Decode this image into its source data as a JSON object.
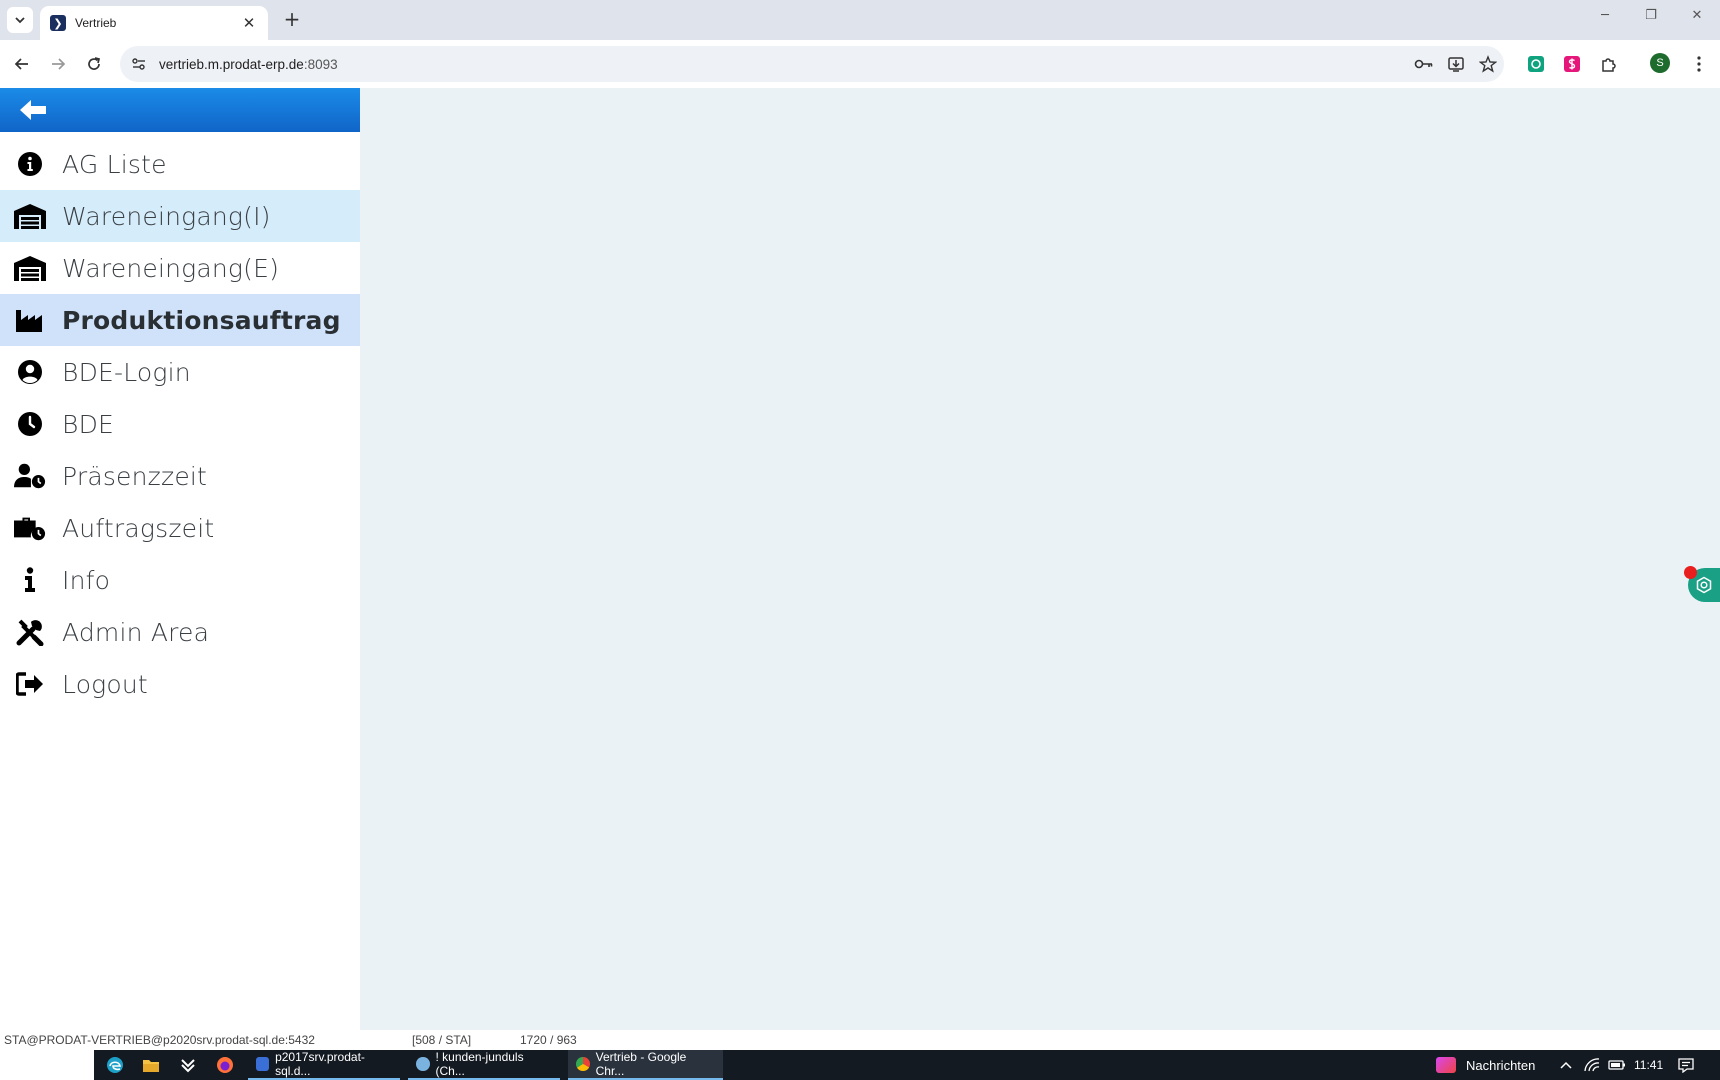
{
  "browser": {
    "tab_title": "Vertrieb",
    "tab_favicon_glyph": "❯",
    "new_tab_label": "+",
    "url_host": "vertrieb.m.prodat-erp.de",
    "url_port": ":8093",
    "profile_initial": "S",
    "accent_color": "#1065c8"
  },
  "sidebar": {
    "back_icon": "arrow-left-icon",
    "items": [
      {
        "label": "AG Liste",
        "icon": "info-circle-icon",
        "state": "normal"
      },
      {
        "label": "Wareneingang(I)",
        "icon": "warehouse-icon",
        "state": "hover"
      },
      {
        "label": "Wareneingang(E)",
        "icon": "warehouse-icon",
        "state": "normal"
      },
      {
        "label": "Produktionsauftrag",
        "icon": "industry-icon",
        "state": "active"
      },
      {
        "label": "BDE-Login",
        "icon": "user-circle-icon",
        "state": "normal"
      },
      {
        "label": "BDE",
        "icon": "clock-icon",
        "state": "normal"
      },
      {
        "label": "Präsenzzeit",
        "icon": "user-clock-icon",
        "state": "normal"
      },
      {
        "label": "Auftragszeit",
        "icon": "briefcase-clock-icon",
        "state": "normal"
      },
      {
        "label": "Info",
        "icon": "info-icon",
        "state": "normal"
      },
      {
        "label": "Admin Area",
        "icon": "tools-icon",
        "state": "normal"
      },
      {
        "label": "Logout",
        "icon": "sign-out-icon",
        "state": "normal"
      }
    ]
  },
  "status_bar": {
    "connection": "STA@PRODAT-VERTRIEB@p2020srv.prodat-sql.de:5432",
    "user": "[508 / STA]",
    "resolution": "1720 / 963"
  },
  "taskbar": {
    "apps": [
      {
        "label": "p2017srv.prodat-sql.d..."
      },
      {
        "label": "! kunden-junduls (Ch..."
      },
      {
        "label": "Vertrieb - Google Chr..."
      }
    ],
    "news_label": "Nachrichten",
    "clock": "11:41"
  }
}
